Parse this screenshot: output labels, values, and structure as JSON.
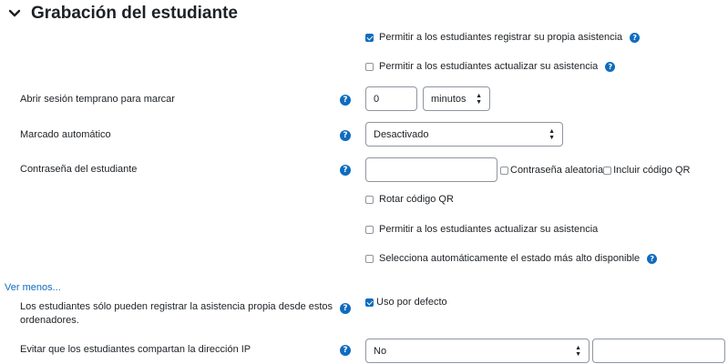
{
  "section": {
    "title": "Grabación del estudiante",
    "toggle_icon": "chevron-down-icon"
  },
  "options_top": {
    "allow_register": {
      "label": "Permitir a los estudiantes registrar su propia asistencia",
      "checked": true
    },
    "allow_update": {
      "label": "Permitir a los estudiantes actualizar su asistencia",
      "checked": false
    }
  },
  "early_session": {
    "label": "Abrir sesión temprano para marcar",
    "value": "0",
    "unit": "minutos"
  },
  "automark": {
    "label": "Marcado automático",
    "value": "Desactivado"
  },
  "student_password": {
    "label": "Contraseña del estudiante",
    "value": "",
    "random_label": "Contraseña aleatoria",
    "random_checked": false,
    "qr_label": "Incluir código QR",
    "qr_checked": false
  },
  "rotate_qr": {
    "label": "Rotar código QR",
    "checked": false
  },
  "allow_update_2": {
    "label": "Permitir a los estudiantes actualizar su asistencia",
    "checked": false
  },
  "auto_highest": {
    "label": "Selecciona automáticamente el estado más alto disponible",
    "checked": false
  },
  "show_less": "Ver menos...",
  "subnet": {
    "label_line1": "Los estudiantes sólo pueden registrar la asistencia propia desde estos",
    "label_line2": "ordenadores.",
    "default_label": "Uso por defecto",
    "default_checked": true
  },
  "prevent_ip": {
    "label": "Evitar que los estudiantes compartan la dirección IP",
    "value": "No",
    "extra_value": ""
  },
  "colors": {
    "accent": "#0f6cbf",
    "text": "#1d2125",
    "border": "#8f959e"
  }
}
